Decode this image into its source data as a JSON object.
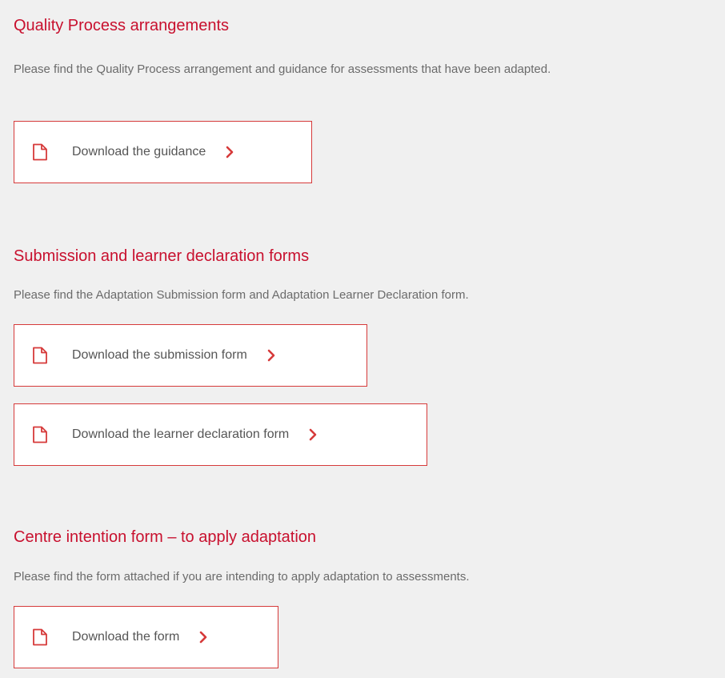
{
  "sections": [
    {
      "heading": "Quality Process arrangements",
      "description": "Please find the Quality Process arrangement and guidance for assessments that have been adapted.",
      "links": [
        {
          "label": "Download the guidance",
          "icon": "document-icon"
        }
      ]
    },
    {
      "heading": "Submission and learner declaration forms",
      "description": "Please find the Adaptation Submission form and Adaptation Learner Declaration form.",
      "links": [
        {
          "label": "Download the submission form",
          "icon": "document-icon"
        },
        {
          "label": "Download the learner declaration form",
          "icon": "document-icon"
        }
      ]
    },
    {
      "heading": "Centre intention form – to apply adaptation",
      "description": "Please find the form attached if you are intending to apply adaptation to assessments.",
      "links": [
        {
          "label": "Download the form",
          "icon": "document-icon"
        }
      ]
    }
  ],
  "colors": {
    "accent": "#c8102e",
    "border": "#d63a3a",
    "body_text": "#6b6b6b",
    "background": "#f0f0f0",
    "button_background": "#ffffff"
  }
}
